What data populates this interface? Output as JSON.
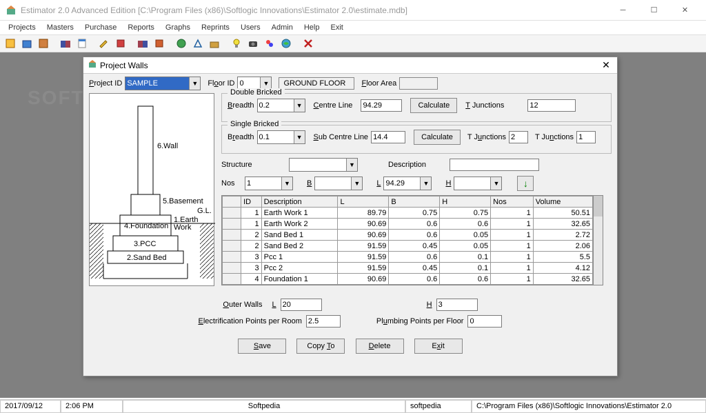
{
  "window": {
    "title": "Estimator 2.0 Advanced Edition  [C:\\Program Files (x86)\\Softlogic Innovations\\Estimator 2.0\\estimate.mdb]"
  },
  "menu": [
    "Projects",
    "Masters",
    "Purchase",
    "Reports",
    "Graphs",
    "Reprints",
    "Users",
    "Admin",
    "Help",
    "Exit"
  ],
  "dialog": {
    "title": "Project Walls",
    "project_id_label": "Project ID",
    "project_id": "SAMPLE",
    "floor_id_label": "Floor ID",
    "floor_id": "0",
    "floor_name": "GROUND FLOOR",
    "floor_area_label": "Floor Area",
    "floor_area": "",
    "double": {
      "legend": "Double Bricked",
      "breadth_label": "Breadth",
      "breadth": "0.2",
      "centre_label": "Centre Line",
      "centre": "94.29",
      "calc": "Calculate",
      "tjunc_label": "T Junctions",
      "tjunc": "12"
    },
    "single": {
      "legend": "Single Bricked",
      "breadth_label": "Breadth",
      "breadth": "0.1",
      "sub_label": "Sub Centre Line",
      "sub": "14.4",
      "calc": "Calculate",
      "tjunc1_label": "T Junctions",
      "tjunc1": "2",
      "tjunc2_label": "T Junctions",
      "tjunc2": "1"
    },
    "structure_label": "Structure",
    "structure": "",
    "description_label": "Description",
    "description": "",
    "nos_label": "Nos",
    "nos": "1",
    "B_label": "B",
    "B": "",
    "L_label": "L",
    "L": "94.29",
    "H_label": "H",
    "H": "",
    "grid": {
      "headers": [
        "ID",
        "Description",
        "L",
        "B",
        "H",
        "Nos",
        "Volume"
      ],
      "rows": [
        [
          "1",
          "Earth Work 1",
          "89.79",
          "0.75",
          "0.75",
          "1",
          "50.51"
        ],
        [
          "1",
          "Earth Work 2",
          "90.69",
          "0.6",
          "0.6",
          "1",
          "32.65"
        ],
        [
          "2",
          "Sand Bed 1",
          "90.69",
          "0.6",
          "0.05",
          "1",
          "2.72"
        ],
        [
          "2",
          "Sand Bed 2",
          "91.59",
          "0.45",
          "0.05",
          "1",
          "2.06"
        ],
        [
          "3",
          "Pcc 1",
          "91.59",
          "0.6",
          "0.1",
          "1",
          "5.5"
        ],
        [
          "3",
          "Pcc 2",
          "91.59",
          "0.45",
          "0.1",
          "1",
          "4.12"
        ],
        [
          "4",
          "Foundation 1",
          "90.69",
          "0.6",
          "0.6",
          "1",
          "32.65"
        ]
      ]
    },
    "outer_walls_label": "Outer Walls",
    "outer_L_label": "L",
    "outer_L": "20",
    "outer_H_label": "H",
    "outer_H": "3",
    "elec_label": "Electrification Points per Room",
    "elec": "2.5",
    "plumb_label": "Plumbing Points per Floor",
    "plumb": "0",
    "buttons": {
      "save": "Save",
      "copy": "Copy To",
      "delete": "Delete",
      "exit": "Exit"
    }
  },
  "diagram": {
    "wall": "6.Wall",
    "basement": "5.Basement",
    "gl": "G.L.",
    "foundation": "4.Foundation",
    "earth": "1.Earth Work",
    "pcc": "3.PCC",
    "sand": "2.Sand Bed"
  },
  "status": {
    "date": "2017/09/12",
    "time": "2:06 PM",
    "org": "Softpedia",
    "org2": "softpedia",
    "path": "C:\\Program Files (x86)\\Softlogic Innovations\\Estimator 2.0"
  }
}
